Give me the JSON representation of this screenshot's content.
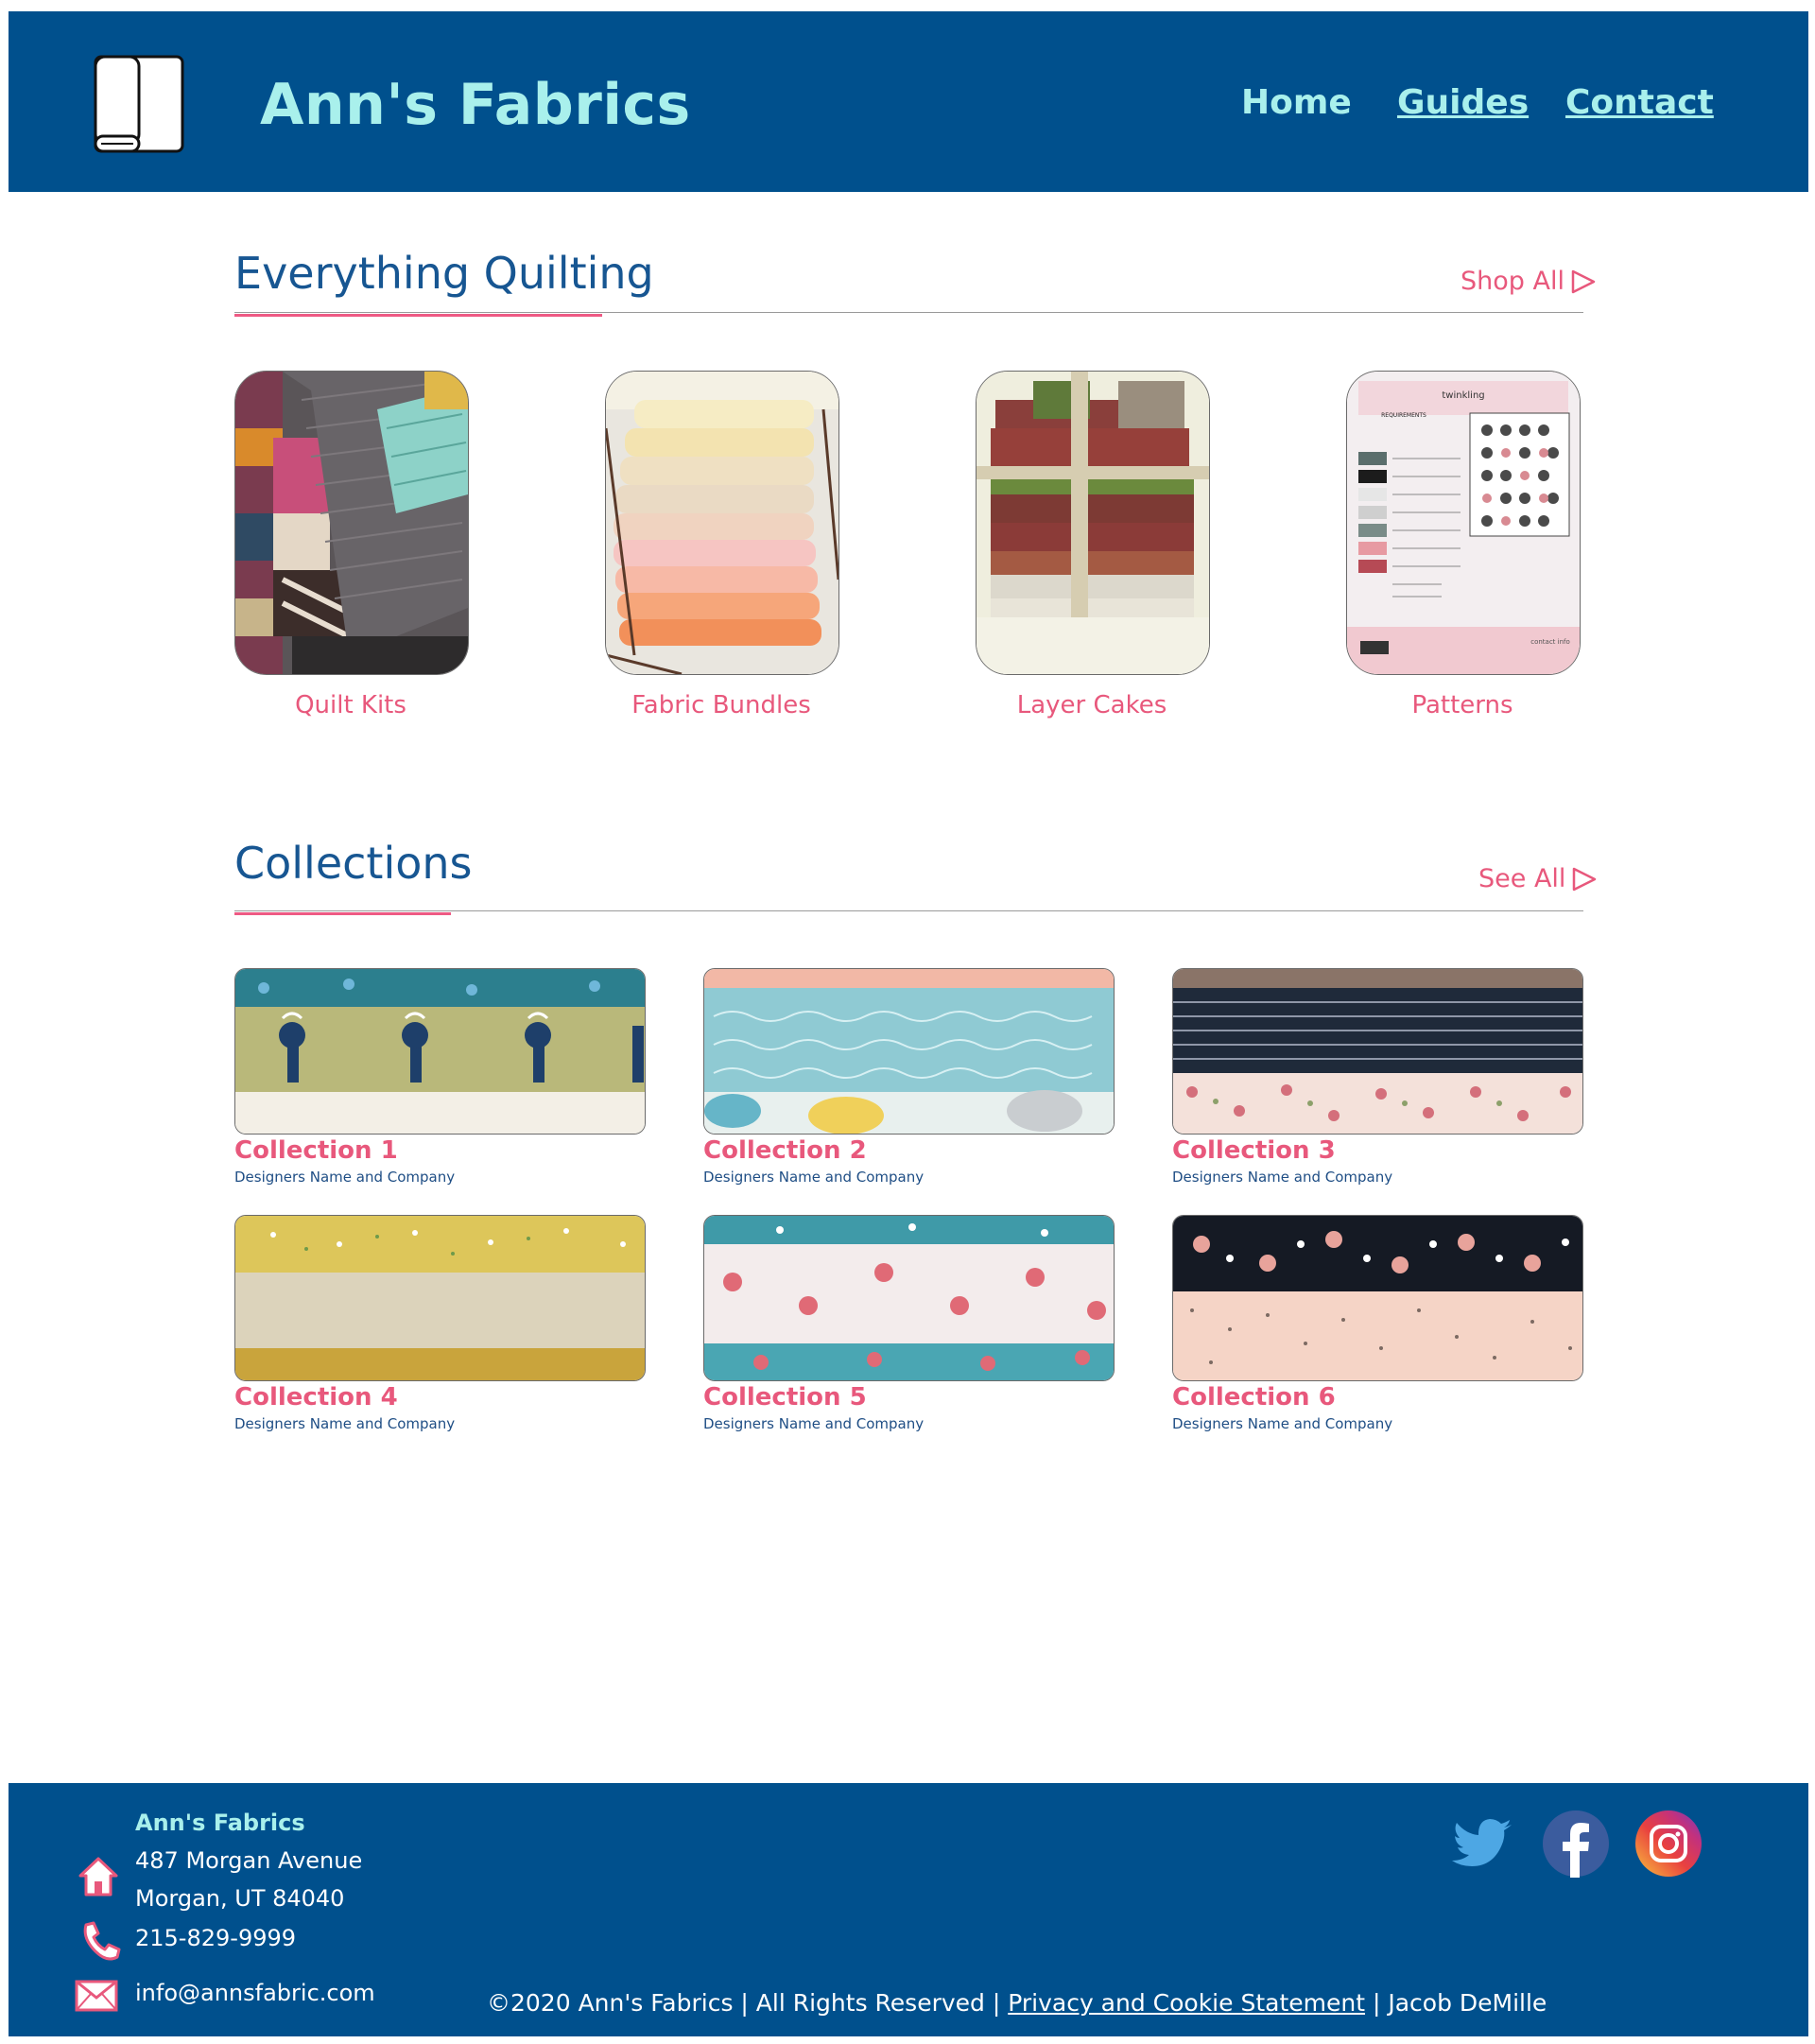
{
  "header": {
    "title": "Ann's Fabrics",
    "nav": {
      "home": "Home",
      "guides": "Guides",
      "contact": "Contact"
    }
  },
  "quilting": {
    "title": "Everything Quilting",
    "link": "Shop All",
    "categories": [
      {
        "label": "Quilt Kits"
      },
      {
        "label": "Fabric Bundles"
      },
      {
        "label": "Layer Cakes"
      },
      {
        "label": "Patterns"
      }
    ],
    "pattern_card": {
      "name": "twinkling",
      "section": "REQUIREMENTS",
      "brand": "contact info"
    }
  },
  "collections": {
    "title": "Collections",
    "link": "See All",
    "items": [
      {
        "title": "Collection 1",
        "subtitle": "Designers Name and Company"
      },
      {
        "title": "Collection 2",
        "subtitle": "Designers Name and Company"
      },
      {
        "title": "Collection 3",
        "subtitle": "Designers Name and Company"
      },
      {
        "title": "Collection 4",
        "subtitle": "Designers Name and Company"
      },
      {
        "title": "Collection 5",
        "subtitle": "Designers Name and Company"
      },
      {
        "title": "Collection 6",
        "subtitle": "Designers Name and Company"
      }
    ]
  },
  "footer": {
    "name": "Ann's Fabrics",
    "address_1": "487 Morgan Avenue",
    "address_2": "Morgan, UT 84040",
    "phone": "215-829-9999",
    "email": "info@annsfabric.com",
    "copyright": "©2020 Ann's Fabrics | All Rights Reserved |",
    "privacy": "Privacy and Cookie Statement",
    "author": "| Jacob DeMille",
    "social": [
      "twitter-icon",
      "facebook-icon",
      "instagram-icon"
    ]
  },
  "colors": {
    "header_bg": "#00508d",
    "title_accent": "#a9f0ec",
    "pink": "#e8587c",
    "heading_blue": "#175692"
  }
}
